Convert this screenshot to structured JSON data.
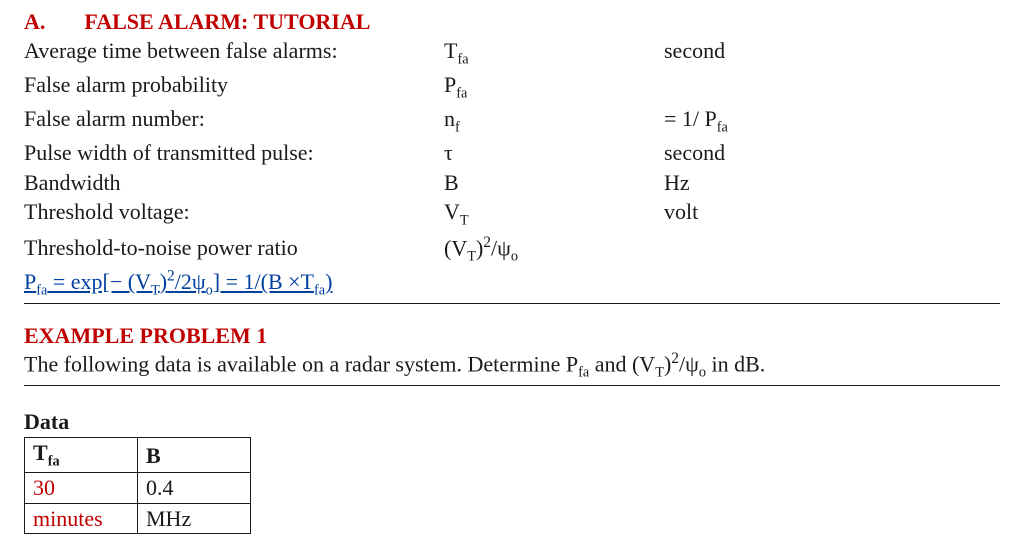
{
  "section": {
    "letter": "A.",
    "title": "FALSE ALARM: TUTORIAL"
  },
  "definitions": [
    {
      "desc": "Average time between false alarms:",
      "sym_html": "T<span class='sub'>fa</span>",
      "unit": "second"
    },
    {
      "desc": "False alarm probability",
      "sym_html": "P<span class='sub'>fa</span>",
      "unit": ""
    },
    {
      "desc": "False alarm number:",
      "sym_html": "n<span class='sub'>f</span>",
      "unit_html": "= 1/ P<span class='sub'>fa</span>"
    },
    {
      "desc": "Pulse width of transmitted pulse:",
      "sym_html": "&tau;",
      "unit": "second"
    },
    {
      "desc": "Bandwidth",
      "sym_html": "B",
      "unit": "Hz"
    },
    {
      "desc": "Threshold voltage:",
      "sym_html": "V<span class='sub'>T</span>",
      "unit": "volt"
    },
    {
      "desc": "Threshold-to-noise power ratio",
      "sym_html": "(V<span class='sub'>T</span>)<span class='sup'>2</span>/&psi;<span class='sub'>o</span>",
      "unit": ""
    }
  ],
  "formula_html": "P<span class='sub'>fa</span> = exp[&minus; (V<span class='sub'>T</span>)<span class='sup'>2</span>/2&psi;<span class='sub'>o</span>] = 1/(B &times;T<span class='sub'>fa</span>)",
  "example": {
    "heading": "EXAMPLE PROBLEM 1",
    "text_html": "The following data is available on a radar system. Determine P<span class='sub'>fa</span> and (V<span class='sub'>T</span>)<span class='sup'>2</span>/&psi;<span class='sub'>o</span> in dB."
  },
  "data": {
    "heading": "Data",
    "headers": [
      {
        "html": "T<span class='sub'>fa</span>",
        "bold": true
      },
      {
        "html": "B",
        "bold": true
      }
    ],
    "values": [
      {
        "html": "30",
        "red": true
      },
      {
        "html": "0.4"
      }
    ],
    "units": [
      {
        "html": "minutes",
        "red": true
      },
      {
        "html": "MHz"
      }
    ]
  }
}
